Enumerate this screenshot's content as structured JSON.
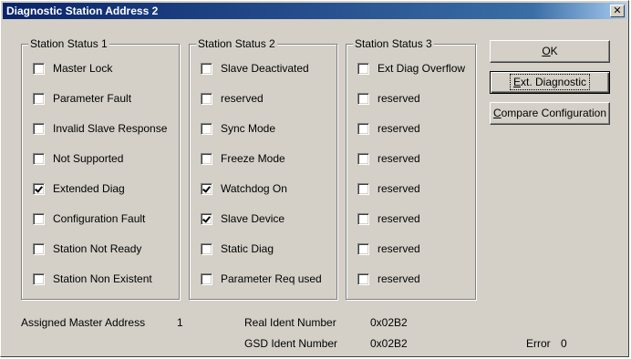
{
  "window": {
    "title": "Diagnostic Station Address 2",
    "close_glyph": "✕"
  },
  "groups": [
    {
      "title": "Station Status 1",
      "items": [
        {
          "label": "Master Lock",
          "checked": false
        },
        {
          "label": "Parameter Fault",
          "checked": false
        },
        {
          "label": "Invalid Slave Response",
          "checked": false
        },
        {
          "label": "Not Supported",
          "checked": false
        },
        {
          "label": "Extended Diag",
          "checked": true
        },
        {
          "label": "Configuration Fault",
          "checked": false
        },
        {
          "label": "Station Not Ready",
          "checked": false
        },
        {
          "label": "Station Non Existent",
          "checked": false
        }
      ]
    },
    {
      "title": "Station Status 2",
      "items": [
        {
          "label": "Slave Deactivated",
          "checked": false
        },
        {
          "label": "reserved",
          "checked": false
        },
        {
          "label": "Sync Mode",
          "checked": false
        },
        {
          "label": "Freeze Mode",
          "checked": false
        },
        {
          "label": "Watchdog On",
          "checked": true
        },
        {
          "label": "Slave Device",
          "checked": true
        },
        {
          "label": "Static Diag",
          "checked": false
        },
        {
          "label": "Parameter Req used",
          "checked": false
        }
      ]
    },
    {
      "title": "Station Status 3",
      "items": [
        {
          "label": "Ext Diag Overflow",
          "checked": false
        },
        {
          "label": "reserved",
          "checked": false
        },
        {
          "label": "reserved",
          "checked": false
        },
        {
          "label": "reserved",
          "checked": false
        },
        {
          "label": "reserved",
          "checked": false
        },
        {
          "label": "reserved",
          "checked": false
        },
        {
          "label": "reserved",
          "checked": false
        },
        {
          "label": "reserved",
          "checked": false
        }
      ]
    }
  ],
  "buttons": {
    "ok": {
      "mnemonic": "O",
      "rest": "K"
    },
    "ext_diag": {
      "mnemonic": "E",
      "rest": "xt. Diagnostic"
    },
    "compare": {
      "mnemonic": "C",
      "rest": "ompare Configuration"
    }
  },
  "info": {
    "assigned_master_label": "Assigned Master Address",
    "assigned_master_value": "1",
    "real_ident_label": "Real Ident Number",
    "real_ident_value": "0x02B2",
    "gsd_ident_label": "GSD Ident Number",
    "gsd_ident_value": "0x02B2",
    "error_label": "Error",
    "error_value": "0"
  }
}
